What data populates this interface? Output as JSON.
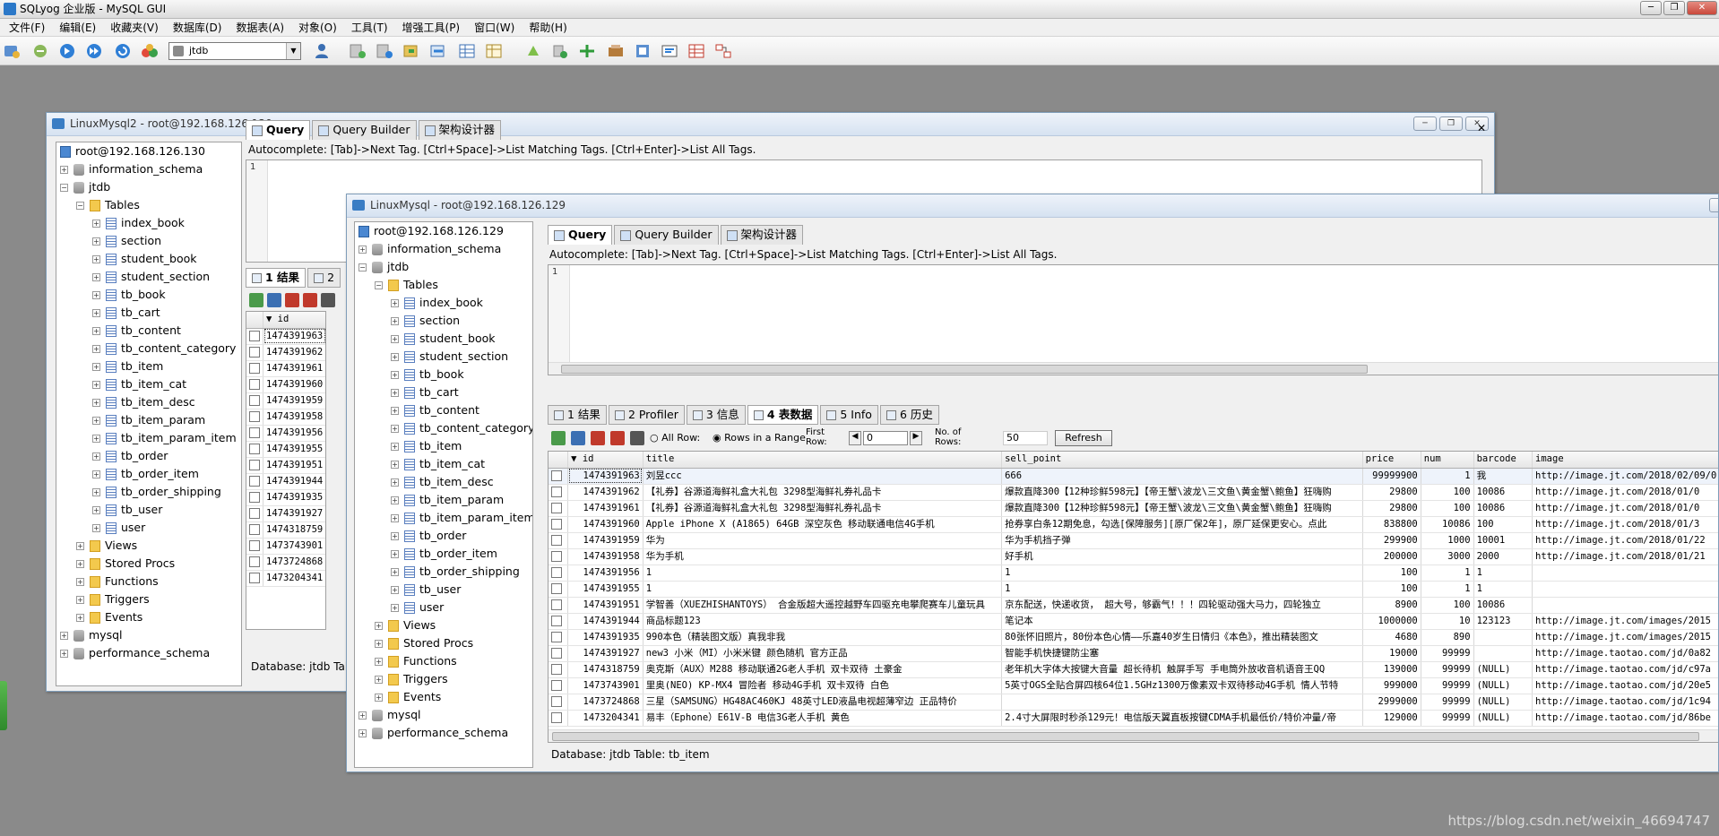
{
  "app": {
    "title": "SQLyog 企业版 - MySQL GUI",
    "menu": [
      "文件(F)",
      "编辑(E)",
      "收藏夹(V)",
      "数据库(D)",
      "数据表(A)",
      "对象(O)",
      "工具(T)",
      "增强工具(P)",
      "窗口(W)",
      "帮助(H)"
    ],
    "db_selector": "jtdb",
    "watermark": "https://blog.csdn.net/weixin_46694747"
  },
  "win_back": {
    "title": "LinuxMysql2 - root@192.168.126.130",
    "server": "root@192.168.126.130",
    "databases": [
      "information_schema",
      "jtdb",
      "mysql",
      "performance_schema"
    ],
    "tables_label": "Tables",
    "tables": [
      "index_book",
      "section",
      "student_book",
      "student_section",
      "tb_book",
      "tb_cart",
      "tb_content",
      "tb_content_category",
      "tb_item",
      "tb_item_cat",
      "tb_item_desc",
      "tb_item_param",
      "tb_item_param_item",
      "tb_order",
      "tb_order_item",
      "tb_order_shipping",
      "tb_user",
      "user"
    ],
    "folders": [
      "Views",
      "Stored Procs",
      "Functions",
      "Triggers",
      "Events"
    ],
    "tabs": [
      "Query",
      "Query Builder",
      "架构设计器"
    ],
    "autocomplete": "Autocomplete: [Tab]->Next Tag. [Ctrl+Space]->List Matching Tags. [Ctrl+Enter]->List All Tags.",
    "line_no": "1",
    "result_tabs": [
      "1 结果",
      "2"
    ],
    "id_header": "id",
    "ids": [
      "1474391963",
      "1474391962",
      "1474391961",
      "1474391960",
      "1474391959",
      "1474391958",
      "1474391956",
      "1474391955",
      "1474391951",
      "1474391944",
      "1474391935",
      "1474391927",
      "1474318759",
      "1473743901",
      "1473724868",
      "1473204341"
    ],
    "status": "Database: jtdb Tab"
  },
  "win_front": {
    "title": "LinuxMysql - root@192.168.126.129",
    "server": "root@192.168.126.129",
    "databases": [
      "information_schema",
      "jtdb",
      "mysql",
      "performance_schema"
    ],
    "tables_label": "Tables",
    "tables": [
      "index_book",
      "section",
      "student_book",
      "student_section",
      "tb_book",
      "tb_cart",
      "tb_content",
      "tb_content_category",
      "tb_item",
      "tb_item_cat",
      "tb_item_desc",
      "tb_item_param",
      "tb_item_param_item",
      "tb_order",
      "tb_order_item",
      "tb_order_shipping",
      "tb_user",
      "user"
    ],
    "folders": [
      "Views",
      "Stored Procs",
      "Functions",
      "Triggers",
      "Events"
    ],
    "tabs": [
      "Query",
      "Query Builder",
      "架构设计器"
    ],
    "autocomplete": "Autocomplete: [Tab]->Next Tag. [Ctrl+Space]->List Matching Tags. [Ctrl+Enter]->List All Tags.",
    "line_no": "1",
    "result_tabs": [
      "1 结果",
      "2 Profiler",
      "3 信息",
      "4 表数据",
      "5 Info",
      "6 历史"
    ],
    "gridbar": {
      "all_row": "All Row:",
      "rows_in_range": "Rows in a Range",
      "first_row": "First Row:",
      "first_row_value": "0",
      "no_of_rows": "No. of Rows:",
      "no_of_rows_value": "50",
      "refresh": "Refresh"
    },
    "columns": [
      "id",
      "title",
      "sell_point",
      "price",
      "num",
      "barcode",
      "image"
    ],
    "rows": [
      [
        "1474391963",
        "刘昱ccc",
        "666",
        "99999900",
        "1",
        "我",
        "http://image.jt.com/2018/02/09/0"
      ],
      [
        "1474391962",
        "【礼券】谷源道海鲜礼盒大礼包 3298型海鲜礼券礼品卡",
        "爆款直降300【12种珍鲜598元】【帝王蟹\\波龙\\三文鱼\\黄金蟹\\鲍鱼】狂嗨购",
        "29800",
        "100",
        "10086",
        "http://image.jt.com/2018/01/0"
      ],
      [
        "1474391961",
        "【礼券】谷源道海鲜礼盒大礼包 3298型海鲜礼券礼品卡",
        "爆款直降300【12种珍鲜598元】【帝王蟹\\波龙\\三文鱼\\黄金蟹\\鲍鱼】狂嗨购",
        "29800",
        "100",
        "10086",
        "http://image.jt.com/2018/01/0"
      ],
      [
        "1474391960",
        "Apple iPhone X (A1865) 64GB 深空灰色 移动联通电信4G手机",
        "抢券享白条12期免息，勾选[保障服务][原厂保2年]，原厂延保更安心。点此",
        "838800",
        "10086",
        "100",
        "http://image.jt.com/2018/01/3"
      ],
      [
        "1474391959",
        "华为",
        "华为手机挡子弹",
        "299900",
        "1000",
        "10001",
        "http://image.jt.com/2018/01/22"
      ],
      [
        "1474391958",
        "华为手机",
        "好手机",
        "200000",
        "3000",
        "2000",
        "http://image.jt.com/2018/01/21"
      ],
      [
        "1474391956",
        "1",
        "1",
        "100",
        "1",
        "1",
        ""
      ],
      [
        "1474391955",
        "1",
        "1",
        "100",
        "1",
        "1",
        ""
      ],
      [
        "1474391951",
        "学智善（XUEZHISHANTOYS） 合金版超大遥控越野车四驱充电攀爬赛车儿童玩具",
        "京东配送，快递收货， 超大号，够霸气！！！四轮驱动强大马力，四轮独立",
        "8900",
        "100",
        "10086",
        ""
      ],
      [
        "1474391944",
        "商品标题123",
        "笔记本",
        "1000000",
        "10",
        "123123",
        "http://image.jt.com/images/2015"
      ],
      [
        "1474391935",
        "990本色（精装图文版）真我非我",
        "80张怀旧照片，80份本色心情——乐嘉40岁生日情归《本色》，推出精装图文",
        "4680",
        "890",
        "",
        "http://image.jt.com/images/2015"
      ],
      [
        "1474391927",
        "new3 小米（MI）小米米键 颜色随机 官方正品",
        "智能手机快捷键防尘塞",
        "19000",
        "99999",
        "",
        "http://image.taotao.com/jd/0a82"
      ],
      [
        "1474318759",
        "奥克斯（AUX）M288 移动联通2G老人手机 双卡双待 土豪金",
        "老年机大字体大按键大音量 超长待机 触屏手写 手电筒外放收音机语音王QQ",
        "139000",
        "99999",
        "(NULL)",
        "http://image.taotao.com/jd/c97a"
      ],
      [
        "1473743901",
        "里奥(NEO) KP-MX4 冒险者 移动4G手机 双卡双待 白色",
        "5英寸OGS全贴合屏四核64位1.5GHz1300万像素双卡双待移动4G手机 情人节特",
        "999000",
        "99999",
        "(NULL)",
        "http://image.taotao.com/jd/20e5"
      ],
      [
        "1473724868",
        "三星（SAMSUNG）HG48AC460KJ 48英寸LED液晶电视超薄窄边 正品特价",
        "",
        "2999000",
        "99999",
        "(NULL)",
        "http://image.taotao.com/jd/1c94"
      ],
      [
        "1473204341",
        "易丰（Ephone）E61V-B 电信3G老人手机 黄色",
        "2.4寸大屏限时秒杀129元！电信版天翼直板按键CDMA手机最低价/特价冲量/帝",
        "129000",
        "99999",
        "(NULL)",
        "http://image.taotao.com/jd/86be"
      ]
    ],
    "status": "Database: jtdb Table: tb_item"
  }
}
